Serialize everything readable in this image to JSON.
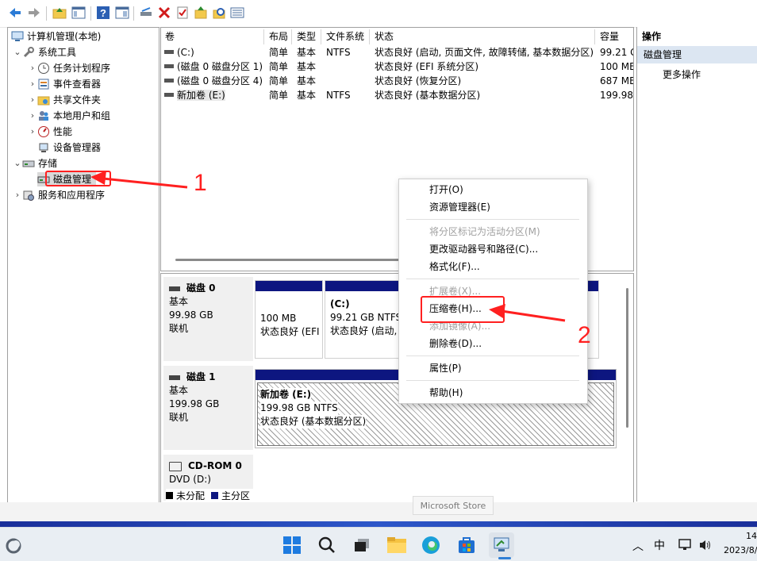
{
  "toolbar": {
    "icons": [
      "back-arrow-icon",
      "forward-arrow-icon",
      "up-folder-icon",
      "show-hide-tree-icon",
      "help-icon",
      "properties-icon",
      "connect-drive-icon",
      "delete-icon",
      "checkmark-icon",
      "new-folder-icon",
      "search-folder-icon",
      "details-icon"
    ]
  },
  "tree": {
    "root": "计算机管理(本地)",
    "items": [
      {
        "label": "系统工具",
        "icon": "tools-icon"
      },
      {
        "label": "任务计划程序",
        "icon": "clock-icon"
      },
      {
        "label": "事件查看器",
        "icon": "event-viewer-icon"
      },
      {
        "label": "共享文件夹",
        "icon": "shared-folder-icon"
      },
      {
        "label": "本地用户和组",
        "icon": "users-icon"
      },
      {
        "label": "性能",
        "icon": "performance-icon"
      },
      {
        "label": "设备管理器",
        "icon": "device-manager-icon"
      },
      {
        "label": "存储",
        "icon": "storage-icon"
      },
      {
        "label": "磁盘管理",
        "icon": "disk-management-icon"
      },
      {
        "label": "服务和应用程序",
        "icon": "services-icon"
      }
    ]
  },
  "volume_list": {
    "columns": [
      "卷",
      "布局",
      "类型",
      "文件系统",
      "状态",
      "容量"
    ],
    "rows": [
      {
        "volume": "(C:)",
        "layout": "简单",
        "type": "基本",
        "fs": "NTFS",
        "status": "状态良好 (启动, 页面文件, 故障转储, 基本数据分区)",
        "capacity": "99.21 G"
      },
      {
        "volume": "(磁盘 0 磁盘分区 1)",
        "layout": "简单",
        "type": "基本",
        "fs": "",
        "status": "状态良好 (EFI 系统分区)",
        "capacity": "100 ME"
      },
      {
        "volume": "(磁盘 0 磁盘分区 4)",
        "layout": "简单",
        "type": "基本",
        "fs": "",
        "status": "状态良好 (恢复分区)",
        "capacity": "687 ME"
      },
      {
        "volume": "新加卷 (E:)",
        "layout": "简单",
        "type": "基本",
        "fs": "NTFS",
        "status": "状态良好 (基本数据分区)",
        "capacity": "199.98"
      }
    ]
  },
  "disks": [
    {
      "name": "磁盘 0",
      "type": "基本",
      "size": "99.98 GB",
      "state": "联机",
      "partitions": [
        {
          "title": "",
          "size": "100 MB",
          "status": "状态良好 (EFI"
        },
        {
          "title": "(C:)",
          "size": "99.21 GB NTFS",
          "status": "状态良好 (启动,"
        },
        {
          "title": "",
          "size": "",
          "status": ""
        }
      ]
    },
    {
      "name": "磁盘 1",
      "type": "基本",
      "size": "199.98 GB",
      "state": "联机",
      "partitions": [
        {
          "title": "新加卷  (E:)",
          "size": "199.98 GB NTFS",
          "status": "状态良好 (基本数据分区)"
        }
      ]
    },
    {
      "name": "CD-ROM 0",
      "type": "DVD (D:)",
      "size": "",
      "state": "",
      "partitions": []
    }
  ],
  "legend": {
    "unallocated": "未分配",
    "primary": "主分区"
  },
  "actions": {
    "header": "操作",
    "section": "磁盘管理",
    "more": "更多操作"
  },
  "context_menu": {
    "items": [
      {
        "label": "打开(O)",
        "enabled": true
      },
      {
        "label": "资源管理器(E)",
        "enabled": true
      },
      {
        "label": "将分区标记为活动分区(M)",
        "enabled": false
      },
      {
        "label": "更改驱动器号和路径(C)...",
        "enabled": true
      },
      {
        "label": "格式化(F)...",
        "enabled": true
      },
      {
        "label": "扩展卷(X)...",
        "enabled": false
      },
      {
        "label": "压缩卷(H)...",
        "enabled": true
      },
      {
        "label": "添加镜像(A)...",
        "enabled": false
      },
      {
        "label": "删除卷(D)...",
        "enabled": true
      },
      {
        "label": "属性(P)",
        "enabled": true
      },
      {
        "label": "帮助(H)",
        "enabled": true
      }
    ]
  },
  "annotations": {
    "step1": "1",
    "step2": "2"
  },
  "tooltip": "Microsoft Store",
  "taskbar": {
    "time": "14:",
    "date": "2023/8/",
    "ime": "中",
    "apps": [
      "weather-icon",
      "start-icon",
      "search-icon",
      "task-view-icon",
      "file-explorer-icon",
      "edge-icon",
      "store-icon",
      "computer-management-icon"
    ]
  },
  "colors": {
    "primary_partition": "#0d1680",
    "unallocated": "#000000",
    "annotation": "#ff2020",
    "selected_action": "#dce6f2"
  }
}
